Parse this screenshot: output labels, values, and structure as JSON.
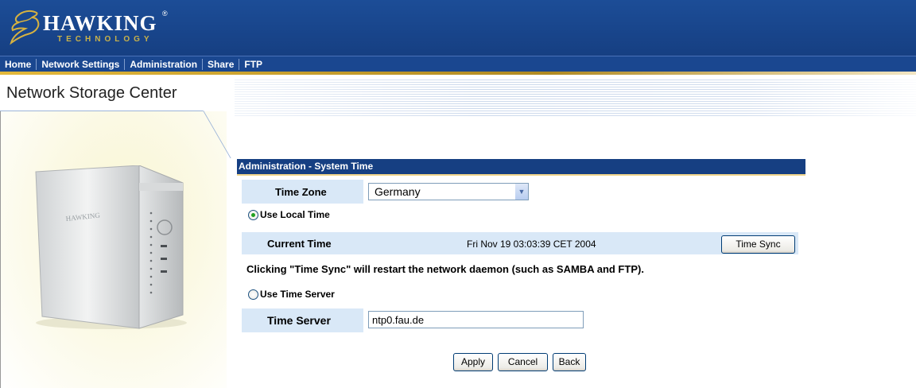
{
  "header": {
    "brand_name": "HAWKING",
    "brand_sub": "TECHNOLOGY",
    "brand_reg": "®",
    "bg_color": "#163f82"
  },
  "nav": {
    "items": [
      {
        "label": "Home"
      },
      {
        "label": "Network Settings"
      },
      {
        "label": "Administration"
      },
      {
        "label": "Share"
      },
      {
        "label": "FTP"
      }
    ]
  },
  "left_panel": {
    "title": "Network Storage Center",
    "device_label": "HAWKING"
  },
  "form": {
    "section_title": "Administration - System Time",
    "time_zone_label": "Time Zone",
    "time_zone_value": "Germany",
    "use_local_time_label": "Use Local Time",
    "use_local_time_checked": true,
    "current_time_label": "Current Time",
    "current_time_value": "Fri Nov 19 03:03:39 CET 2004",
    "time_sync_button": "Time Sync",
    "sync_note": "Clicking \"Time Sync\" will restart the network daemon (such as SAMBA and FTP).",
    "use_time_server_label": "Use Time Server",
    "use_time_server_checked": false,
    "time_server_label": "Time Server",
    "time_server_value": "ntp0.fau.de"
  },
  "actions": {
    "apply": "Apply",
    "cancel": "Cancel",
    "back": "Back"
  }
}
